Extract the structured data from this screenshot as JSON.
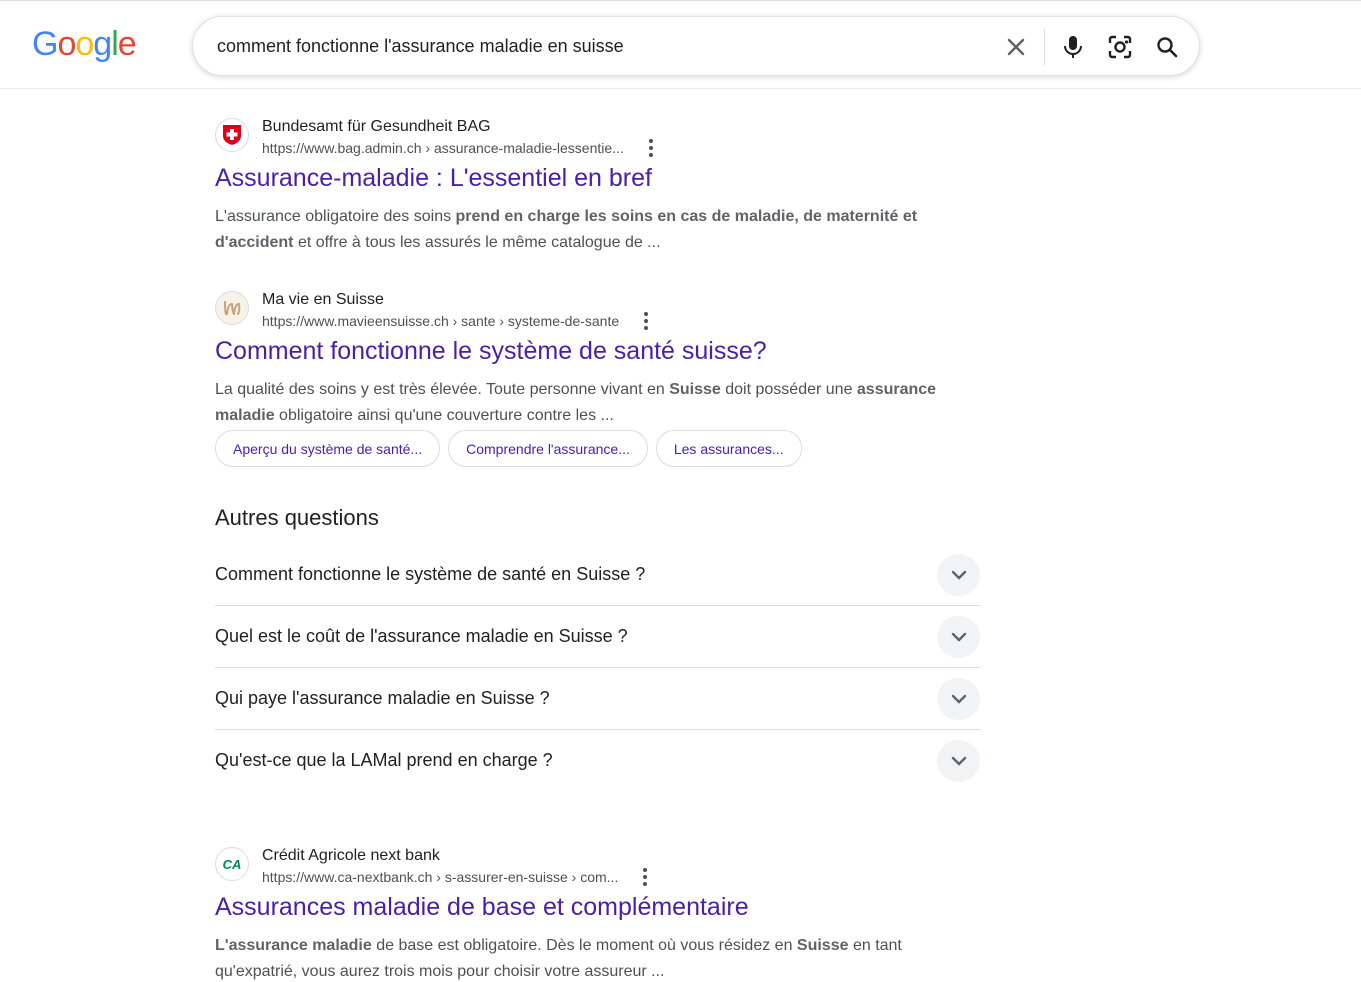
{
  "header": {
    "logo_letters": [
      "G",
      "o",
      "o",
      "g",
      "l",
      "e"
    ],
    "logo_colors": [
      "#4285F4",
      "#EA4335",
      "#FBBC05",
      "#4285F4",
      "#34A853",
      "#EA4335"
    ],
    "search_query": "comment fonctionne l'assurance maladie en suisse",
    "icons": [
      "close-icon",
      "microphone-icon",
      "lens-icon",
      "search-icon"
    ]
  },
  "results": [
    {
      "site_name": "Bundesamt für Gesundheit BAG",
      "url": "https://www.bag.admin.ch › assurance-maladie-lessentie...",
      "title": "Assurance-maladie : L'essentiel en bref",
      "snippet_parts": [
        {
          "text": "L'assurance obligatoire des soins ",
          "bold": false
        },
        {
          "text": "prend en charge les soins en cas de maladie, de maternité et d'accident",
          "bold": true
        },
        {
          "text": " et offre à tous les assurés le même catalogue de ...",
          "bold": false
        }
      ],
      "favicon": "swiss-cross-icon"
    },
    {
      "site_name": "Ma vie en Suisse",
      "url": "https://www.mavieensuisse.ch › sante › systeme-de-sante",
      "title": "Comment fonctionne le système de santé suisse?",
      "snippet_parts": [
        {
          "text": "La qualité des soins y est très élevée. Toute personne vivant en ",
          "bold": false
        },
        {
          "text": "Suisse",
          "bold": true
        },
        {
          "text": " doit posséder une ",
          "bold": false
        },
        {
          "text": "assurance maladie",
          "bold": true
        },
        {
          "text": " obligatoire ainsi qu'une couverture contre les ...",
          "bold": false
        }
      ],
      "favicon": "mavie-logo-icon",
      "chips": [
        "Aperçu du système de santé...",
        "Comprendre l'assurance...",
        "Les assurances..."
      ]
    },
    {
      "site_name": "Crédit Agricole next bank",
      "url": "https://www.ca-nextbank.ch › s-assurer-en-suisse › com...",
      "title": "Assurances maladie de base et complémentaire",
      "snippet_parts": [
        {
          "text": "L'assurance maladie",
          "bold": true
        },
        {
          "text": " de base est obligatoire. Dès le moment où vous résidez en ",
          "bold": false
        },
        {
          "text": "Suisse",
          "bold": true
        },
        {
          "text": " en tant qu'expatrié, vous aurez trois mois pour choisir votre assureur ...",
          "bold": false
        }
      ],
      "favicon": "credit-agricole-logo-icon",
      "favicon_text": "CA"
    }
  ],
  "paa": {
    "title": "Autres questions",
    "questions": [
      "Comment fonctionne le système de santé en Suisse ?",
      "Quel est le coût de l'assurance maladie en Suisse ?",
      "Qui paye l'assurance maladie en Suisse ?",
      "Qu'est-ce que la LAMal prend en charge ?"
    ]
  },
  "colors": {
    "link": "#4a1ea8",
    "url": "#4d5156",
    "snippet": "#4d5156"
  }
}
